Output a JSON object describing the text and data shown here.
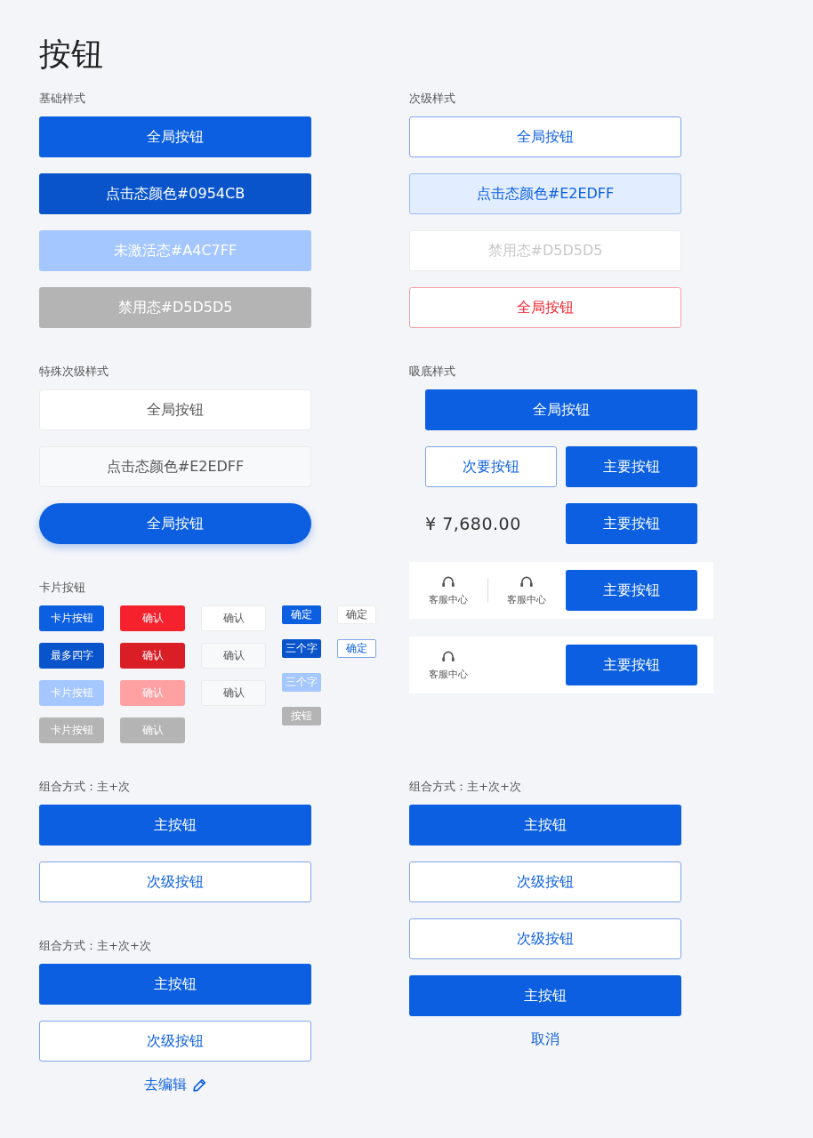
{
  "title": "按钮",
  "rows": [
    {
      "left": [
        {
          "label": "基础样式",
          "kind": "plain",
          "items": [
            {
              "kind": "primary",
              "label": "全局按钮"
            },
            {
              "kind": "pressed",
              "label": "点击态颜色#0954CB"
            },
            {
              "kind": "inactive",
              "label": "未激活态#A4C7FF"
            },
            {
              "kind": "disabled",
              "label": "禁用态#D5D5D5"
            }
          ]
        }
      ],
      "right": [
        {
          "label": "次级样式",
          "kind": "plain",
          "items": [
            {
              "kind": "outline",
              "label": "全局按钮"
            },
            {
              "kind": "outline_pressed",
              "label": "点击态颜色#E2EDFF"
            },
            {
              "kind": "outline_disabled",
              "label": "禁用态#D5D5D5"
            },
            {
              "kind": "outline_danger",
              "label": "全局按钮"
            }
          ]
        }
      ]
    },
    {
      "left": [
        {
          "label": "特殊次级样式",
          "kind": "plain",
          "items": [
            {
              "kind": "plain",
              "label": "全局按钮"
            },
            {
              "kind": "plain_pressed",
              "label": "点击态颜色#E2EDFF"
            },
            {
              "kind": "pill",
              "label": "全局按钮"
            }
          ]
        },
        {
          "label": "卡片按钮",
          "kind": "plain",
          "items": [
            {
              "kind": "card_grid",
              "columns": [
                {
                  "kind": "card",
                  "buttons": [
                    {
                      "kind": "primary",
                      "label": "卡片按钮"
                    },
                    {
                      "kind": "pressed",
                      "label": "最多四字"
                    },
                    {
                      "kind": "inactive",
                      "label": "卡片按钮"
                    },
                    {
                      "kind": "disabled",
                      "label": "卡片按钮"
                    }
                  ]
                },
                {
                  "kind": "card",
                  "buttons": [
                    {
                      "kind": "danger",
                      "label": "确认"
                    },
                    {
                      "kind": "danger_pressed",
                      "label": "确认"
                    },
                    {
                      "kind": "danger_inactive",
                      "label": "确认"
                    },
                    {
                      "kind": "disabled",
                      "label": "确认"
                    }
                  ]
                },
                {
                  "kind": "card",
                  "buttons": [
                    {
                      "kind": "plain",
                      "label": "确认"
                    },
                    {
                      "kind": "plain_pressed",
                      "label": "确认"
                    },
                    {
                      "kind": "plain_pressed",
                      "label": "确认"
                    }
                  ]
                },
                {
                  "kind": "tag",
                  "buttons": [
                    {
                      "kind": "primary",
                      "label": "确定"
                    },
                    {
                      "kind": "pressed",
                      "label": "三个字"
                    },
                    {
                      "kind": "inactive",
                      "label": "三个字"
                    },
                    {
                      "kind": "disabled",
                      "label": "按钮"
                    }
                  ]
                },
                {
                  "kind": "tag",
                  "buttons": [
                    {
                      "kind": "plain",
                      "label": "确定"
                    },
                    {
                      "kind": "outline",
                      "label": "确定"
                    }
                  ]
                }
              ]
            }
          ]
        }
      ],
      "right": [
        {
          "label": "吸底样式",
          "kind": "bottom_bar",
          "items": [
            {
              "kind": "primary",
              "label": "全局按钮"
            },
            {
              "kind": "pair",
              "buttons": [
                {
                  "kind": "outline",
                  "label": "次要按钮"
                },
                {
                  "kind": "primary",
                  "label": "主要按钮"
                }
              ]
            },
            {
              "kind": "price",
              "price": "¥ 7,680.00",
              "button": {
                "kind": "primary",
                "label": "主要按钮"
              }
            },
            {
              "kind": "service_bar",
              "services": [
                "客服中心",
                "客服中心"
              ],
              "button": {
                "kind": "primary",
                "label": "主要按钮"
              }
            },
            {
              "kind": "service_bar",
              "services": [
                "客服中心"
              ],
              "button": {
                "kind": "primary",
                "label": "主要按钮"
              }
            }
          ]
        }
      ]
    },
    {
      "left": [
        {
          "label": "组合方式：主+次",
          "kind": "plain",
          "items": [
            {
              "kind": "primary",
              "label": "主按钮"
            },
            {
              "kind": "outline",
              "label": "次级按钮"
            }
          ]
        },
        {
          "label": "组合方式：主+次+次",
          "kind": "plain",
          "items": [
            {
              "kind": "primary",
              "label": "主按钮"
            },
            {
              "kind": "outline",
              "label": "次级按钮"
            },
            {
              "kind": "link",
              "label": "去编辑",
              "edit_icon": true
            }
          ]
        }
      ],
      "right": [
        {
          "label": "组合方式：主+次+次",
          "kind": "plain",
          "items": [
            {
              "kind": "primary",
              "label": "主按钮"
            },
            {
              "kind": "outline",
              "label": "次级按钮"
            },
            {
              "kind": "outline",
              "label": "次级按钮"
            },
            {
              "kind": "primary",
              "label": "主按钮"
            },
            {
              "kind": "link",
              "label": "取消",
              "edit_icon": false
            }
          ]
        }
      ]
    }
  ]
}
